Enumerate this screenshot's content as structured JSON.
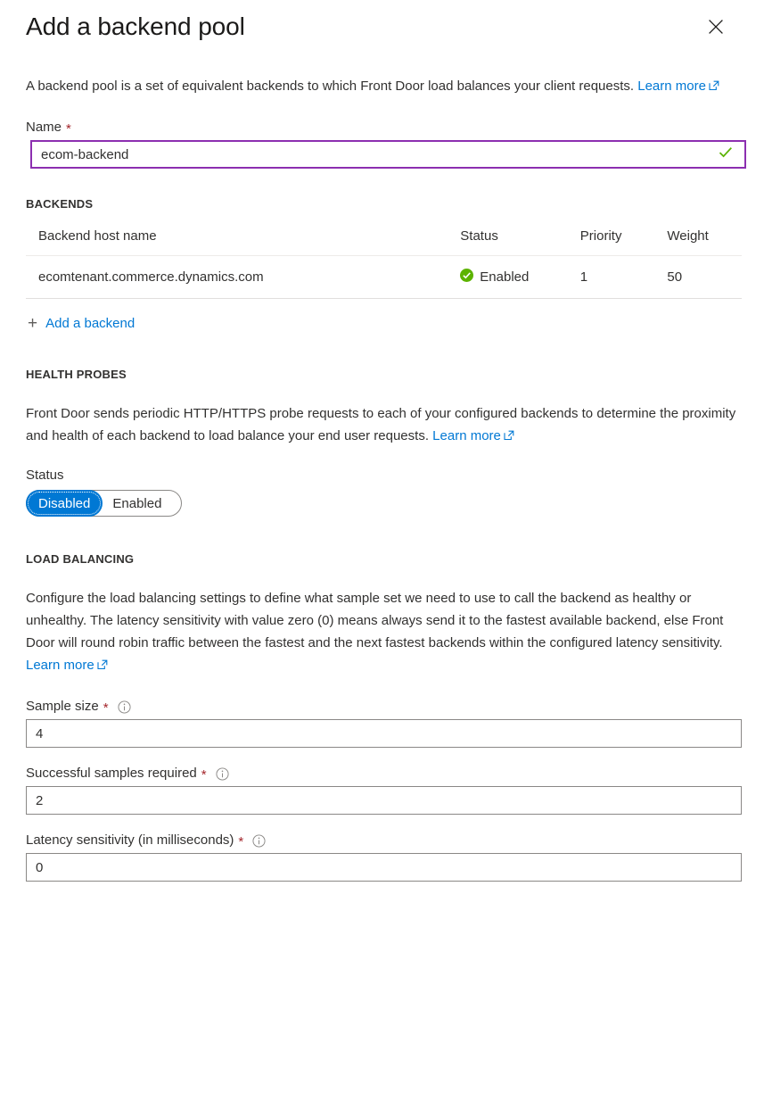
{
  "blade": {
    "title": "Add a backend pool",
    "close_icon": "close-icon"
  },
  "intro": {
    "text": "A backend pool is a set of equivalent backends to which Front Door load balances your client requests.",
    "link_label": "Learn more",
    "link_icon": "external-link-icon"
  },
  "name_field": {
    "label": "Name",
    "required_marker": "*",
    "value": "ecom-backend",
    "placeholder": "",
    "valid_icon": "checkmark-icon",
    "border_color": "#8c2fb0",
    "valid_color": "#5cb300"
  },
  "backends": {
    "section_title": "BACKENDS",
    "columns": [
      "Backend host name",
      "Status",
      "Priority",
      "Weight"
    ],
    "rows": [
      {
        "host": "ecomtenant.commerce.dynamics.com",
        "status": "Enabled",
        "status_icon": "status-enabled-check-icon",
        "status_color": "#5cb300",
        "priority": "1",
        "weight": "50"
      }
    ],
    "add_label": "Add a backend",
    "add_icon": "plus-icon"
  },
  "health_probes": {
    "section_title": "HEALTH PROBES",
    "description": "Front Door sends periodic HTTP/HTTPS probe requests to each of your configured backends to determine the proximity and health of each backend to load balance your end user requests.",
    "link_label": "Learn more",
    "link_icon": "external-link-icon",
    "status_label": "Status",
    "toggle": {
      "options": [
        "Disabled",
        "Enabled"
      ],
      "selected": "Disabled",
      "selected_color": "#0078d4"
    }
  },
  "load_balancing": {
    "section_title": "LOAD BALANCING",
    "description": "Configure the load balancing settings to define what sample set we need to use to call the backend as healthy or unhealthy. The latency sensitivity with value zero (0) means always send it to the fastest available backend, else Front Door will round robin traffic between the fastest and the next fastest backends within the configured latency sensitivity.",
    "link_label": "Learn more",
    "link_icon": "external-link-icon",
    "fields": [
      {
        "label": "Sample size",
        "required_marker": "*",
        "info_icon": "info-icon",
        "value": "4",
        "placeholder": ""
      },
      {
        "label": "Successful samples required",
        "required_marker": "*",
        "info_icon": "info-icon",
        "value": "2",
        "placeholder": ""
      },
      {
        "label": "Latency sensitivity (in milliseconds)",
        "required_marker": "*",
        "info_icon": "info-icon",
        "value": "0",
        "placeholder": ""
      }
    ]
  },
  "theme": {
    "link_color": "#0078d4",
    "required_color": "#a4262c",
    "text_color": "#323130"
  }
}
